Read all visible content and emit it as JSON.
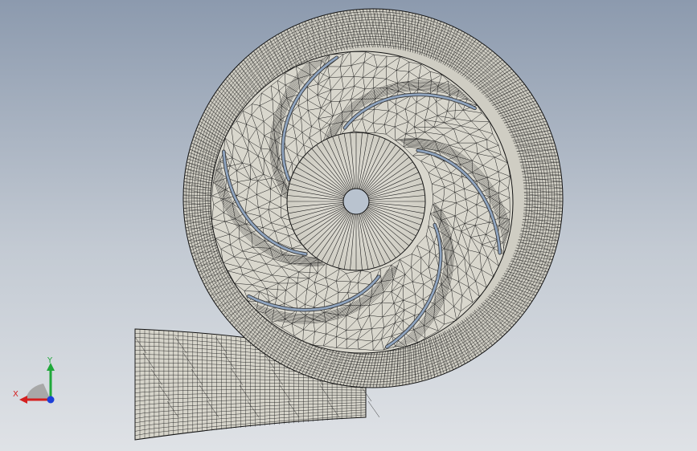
{
  "viewport": {
    "model": "volute-pump-mesh",
    "view": "front"
  },
  "colors": {
    "background_top": "#8c9aae",
    "background_bottom": "#dfe2e6",
    "surface": "#d8d6cc",
    "mesh_line": "#1a1a1a",
    "blade": "#8fa4bf",
    "axis_x": "#d42020",
    "axis_y": "#1fa83a",
    "axis_z": "#1c3fd8",
    "triad_plane": "#a8a8a8"
  },
  "triad": {
    "x_label": "X",
    "y_label": "Y"
  }
}
